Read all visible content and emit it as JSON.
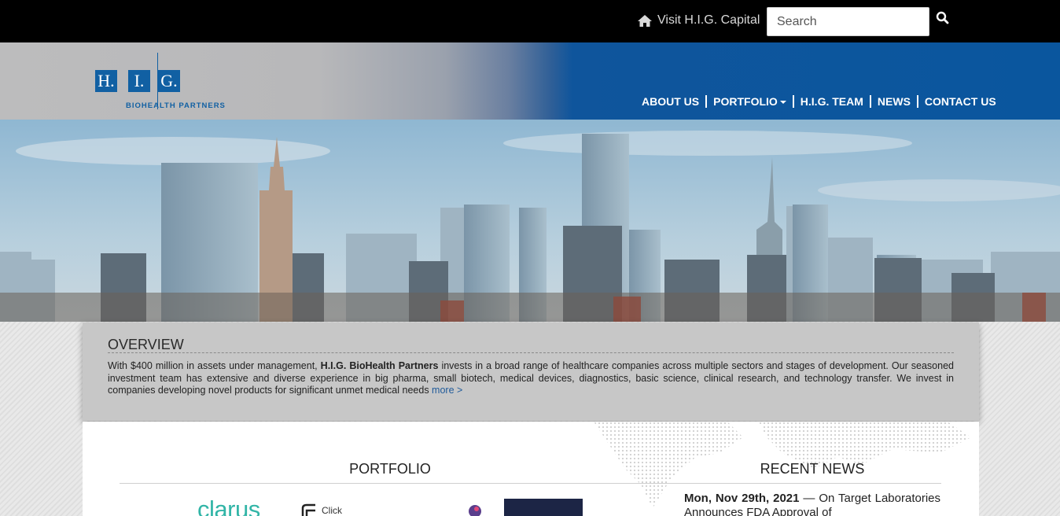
{
  "topbar": {
    "visit_label": "Visit H.I.G. Capital",
    "search_placeholder": "Search"
  },
  "logo": {
    "letters": [
      "H.",
      "I.",
      "G."
    ],
    "subtitle": "BIOHEALTH PARTNERS"
  },
  "nav": {
    "items": [
      "ABOUT US",
      "PORTFOLIO",
      "H.I.G. TEAM",
      "NEWS",
      "CONTACT US"
    ]
  },
  "overview": {
    "title": "OVERVIEW",
    "text_before": "With $400 million in assets under management, ",
    "text_bold": "H.I.G. BioHealth Partners",
    "text_after": " invests in a broad range of healthcare companies across multiple sectors and stages of development. Our seasoned investment team has extensive and diverse experience in big pharma, small biotech, medical devices, diagnostics, basic science, clinical research, and technology transfer. We invest in companies developing novel products for significant unmet medical needs ",
    "more_link": "more >"
  },
  "portfolio": {
    "title": "PORTFOLIO",
    "logos": [
      "clarus",
      "Click"
    ]
  },
  "news": {
    "title": "RECENT NEWS",
    "date": "Mon, Nov 29th, 2021",
    "headline": " — On Target Laboratories Announces FDA Approval of"
  },
  "colors": {
    "brand_blue": "#1160a3",
    "header_blue": "#0a569e",
    "topbar": "#000000",
    "link": "#1f5a9a"
  }
}
